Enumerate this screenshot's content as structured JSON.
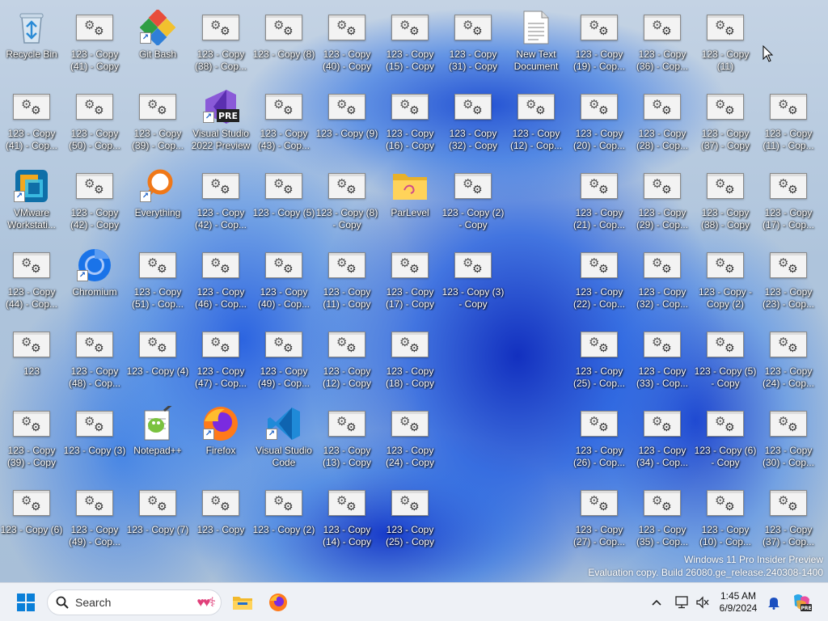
{
  "desktop": {
    "icons": [
      {
        "label": "Recycle Bin",
        "type": "recycle",
        "col": 0,
        "row": 0
      },
      {
        "label": "123 - Copy (41) - Copy",
        "type": "file",
        "col": 1,
        "row": 0
      },
      {
        "label": "Git Bash",
        "type": "gitbash",
        "col": 2,
        "row": 0,
        "shortcut": true
      },
      {
        "label": "123 - Copy (38) - Cop...",
        "type": "file",
        "col": 3,
        "row": 0
      },
      {
        "label": "123 - Copy (8)",
        "type": "file",
        "col": 4,
        "row": 0
      },
      {
        "label": "123 - Copy (40) - Copy",
        "type": "file",
        "col": 5,
        "row": 0
      },
      {
        "label": "123 - Copy (15) - Copy",
        "type": "file",
        "col": 6,
        "row": 0
      },
      {
        "label": "123 - Copy (31) - Copy",
        "type": "file",
        "col": 7,
        "row": 0
      },
      {
        "label": "New Text Document",
        "type": "text",
        "col": 8,
        "row": 0
      },
      {
        "label": "123 - Copy (19) - Cop...",
        "type": "file",
        "col": 9,
        "row": 0
      },
      {
        "label": "123 - Copy (36) - Cop...",
        "type": "file",
        "col": 10,
        "row": 0
      },
      {
        "label": "123 - Copy (11)",
        "type": "file",
        "col": 11,
        "row": 0
      },
      {
        "label": "123 - Copy (41) - Cop...",
        "type": "file",
        "col": 0,
        "row": 1
      },
      {
        "label": "123 - Copy (50) - Cop...",
        "type": "file",
        "col": 1,
        "row": 1
      },
      {
        "label": "123 - Copy (39) - Cop...",
        "type": "file",
        "col": 2,
        "row": 1
      },
      {
        "label": "Visual Studio 2022 Preview",
        "type": "vspre",
        "col": 3,
        "row": 1,
        "shortcut": true
      },
      {
        "label": "123 - Copy (43) - Cop...",
        "type": "file",
        "col": 4,
        "row": 1
      },
      {
        "label": "123 - Copy (9)",
        "type": "file",
        "col": 5,
        "row": 1
      },
      {
        "label": "123 - Copy (16) - Copy",
        "type": "file",
        "col": 6,
        "row": 1
      },
      {
        "label": "123 - Copy (32) - Copy",
        "type": "file",
        "col": 7,
        "row": 1
      },
      {
        "label": "123 - Copy (12) - Cop...",
        "type": "file",
        "col": 8,
        "row": 1
      },
      {
        "label": "123 - Copy (20) - Cop...",
        "type": "file",
        "col": 9,
        "row": 1
      },
      {
        "label": "123 - Copy (28) - Cop...",
        "type": "file",
        "col": 10,
        "row": 1
      },
      {
        "label": "123 - Copy (37) - Copy",
        "type": "file",
        "col": 11,
        "row": 1
      },
      {
        "label": "123 - Copy (11) - Cop...",
        "type": "file",
        "col": 12,
        "row": 1
      },
      {
        "label": "VMware Workstati...",
        "type": "vmware",
        "col": 0,
        "row": 2,
        "shortcut": true
      },
      {
        "label": "123 - Copy (42) - Copy",
        "type": "file",
        "col": 1,
        "row": 2
      },
      {
        "label": "Everything",
        "type": "everything",
        "col": 2,
        "row": 2,
        "shortcut": true
      },
      {
        "label": "123 - Copy (42) - Cop...",
        "type": "file",
        "col": 3,
        "row": 2
      },
      {
        "label": "123 - Copy (5)",
        "type": "file",
        "col": 4,
        "row": 2
      },
      {
        "label": "123 - Copy (8) - Copy",
        "type": "file",
        "col": 5,
        "row": 2
      },
      {
        "label": "ParLevel",
        "type": "folder",
        "col": 6,
        "row": 2
      },
      {
        "label": "123 - Copy (2) - Copy",
        "type": "file",
        "col": 7,
        "row": 2
      },
      {
        "label": "123 - Copy (21) - Cop...",
        "type": "file",
        "col": 9,
        "row": 2
      },
      {
        "label": "123 - Copy (29) - Cop...",
        "type": "file",
        "col": 10,
        "row": 2
      },
      {
        "label": "123 - Copy (38) - Copy",
        "type": "file",
        "col": 11,
        "row": 2
      },
      {
        "label": "123 - Copy (17) - Cop...",
        "type": "file",
        "col": 12,
        "row": 2
      },
      {
        "label": "123 - Copy (44) - Cop...",
        "type": "file",
        "col": 0,
        "row": 3
      },
      {
        "label": "Chromium",
        "type": "chromium",
        "col": 1,
        "row": 3,
        "shortcut": true
      },
      {
        "label": "123 - Copy (51) - Cop...",
        "type": "file",
        "col": 2,
        "row": 3
      },
      {
        "label": "123 - Copy (46) - Cop...",
        "type": "file",
        "col": 3,
        "row": 3
      },
      {
        "label": "123 - Copy (40) - Cop...",
        "type": "file",
        "col": 4,
        "row": 3
      },
      {
        "label": "123 - Copy (11) - Copy",
        "type": "file",
        "col": 5,
        "row": 3
      },
      {
        "label": "123 - Copy (17) - Copy",
        "type": "file",
        "col": 6,
        "row": 3
      },
      {
        "label": "123 - Copy (3) - Copy",
        "type": "file",
        "col": 7,
        "row": 3
      },
      {
        "label": "123 - Copy (22) - Cop...",
        "type": "file",
        "col": 9,
        "row": 3
      },
      {
        "label": "123 - Copy (32) - Cop...",
        "type": "file",
        "col": 10,
        "row": 3
      },
      {
        "label": "123 - Copy - Copy (2)",
        "type": "file",
        "col": 11,
        "row": 3
      },
      {
        "label": "123 - Copy (23) - Cop...",
        "type": "file",
        "col": 12,
        "row": 3
      },
      {
        "label": "123",
        "type": "file",
        "col": 0,
        "row": 4
      },
      {
        "label": "123 - Copy (48) - Cop...",
        "type": "file",
        "col": 1,
        "row": 4
      },
      {
        "label": "123 - Copy (4)",
        "type": "file",
        "col": 2,
        "row": 4
      },
      {
        "label": "123 - Copy (47) - Cop...",
        "type": "file",
        "col": 3,
        "row": 4
      },
      {
        "label": "123 - Copy (49) - Cop...",
        "type": "file",
        "col": 4,
        "row": 4
      },
      {
        "label": "123 - Copy (12) - Copy",
        "type": "file",
        "col": 5,
        "row": 4
      },
      {
        "label": "123 - Copy (18) - Copy",
        "type": "file",
        "col": 6,
        "row": 4
      },
      {
        "label": "123 - Copy (25) - Cop...",
        "type": "file",
        "col": 9,
        "row": 4
      },
      {
        "label": "123 - Copy (33) - Cop...",
        "type": "file",
        "col": 10,
        "row": 4
      },
      {
        "label": "123 - Copy (5) - Copy",
        "type": "file",
        "col": 11,
        "row": 4
      },
      {
        "label": "123 - Copy (24) - Cop...",
        "type": "file",
        "col": 12,
        "row": 4
      },
      {
        "label": "123 - Copy (39) - Copy",
        "type": "file",
        "col": 0,
        "row": 5
      },
      {
        "label": "123 - Copy (3)",
        "type": "file",
        "col": 1,
        "row": 5
      },
      {
        "label": "Notepad++",
        "type": "notepadpp",
        "col": 2,
        "row": 5
      },
      {
        "label": "Firefox",
        "type": "firefox",
        "col": 3,
        "row": 5,
        "shortcut": true
      },
      {
        "label": "Visual Studio Code",
        "type": "vscode",
        "col": 4,
        "row": 5,
        "shortcut": true
      },
      {
        "label": "123 - Copy (13) - Copy",
        "type": "file",
        "col": 5,
        "row": 5
      },
      {
        "label": "123 - Copy (24) - Copy",
        "type": "file",
        "col": 6,
        "row": 5
      },
      {
        "label": "123 - Copy (26) - Cop...",
        "type": "file",
        "col": 9,
        "row": 5
      },
      {
        "label": "123 - Copy (34) - Cop...",
        "type": "file",
        "col": 10,
        "row": 5
      },
      {
        "label": "123 - Copy (6) - Copy",
        "type": "file",
        "col": 11,
        "row": 5
      },
      {
        "label": "123 - Copy (30) - Cop...",
        "type": "file",
        "col": 12,
        "row": 5
      },
      {
        "label": "123 - Copy (6)",
        "type": "file",
        "col": 0,
        "row": 6
      },
      {
        "label": "123 - Copy (49) - Cop...",
        "type": "file",
        "col": 1,
        "row": 6
      },
      {
        "label": "123 - Copy (7)",
        "type": "file",
        "col": 2,
        "row": 6
      },
      {
        "label": "123 - Copy",
        "type": "file",
        "col": 3,
        "row": 6
      },
      {
        "label": "123 - Copy (2)",
        "type": "file",
        "col": 4,
        "row": 6
      },
      {
        "label": "123 - Copy (14) - Copy",
        "type": "file",
        "col": 5,
        "row": 6
      },
      {
        "label": "123 - Copy (25) - Copy",
        "type": "file",
        "col": 6,
        "row": 6
      },
      {
        "label": "123 - Copy (27) - Cop...",
        "type": "file",
        "col": 9,
        "row": 6
      },
      {
        "label": "123 - Copy (35) - Cop...",
        "type": "file",
        "col": 10,
        "row": 6
      },
      {
        "label": "123 - Copy (10) - Cop...",
        "type": "file",
        "col": 11,
        "row": 6
      },
      {
        "label": "123 - Copy (37) - Cop...",
        "type": "file",
        "col": 12,
        "row": 6
      }
    ]
  },
  "watermark": {
    "line1": "Windows 11 Pro Insider Preview",
    "line2": "Evaluation copy. Build 26080.ge_release.240308-1400"
  },
  "taskbar": {
    "search_placeholder": "Search",
    "time": "1:45 AM",
    "date": "6/9/2024"
  },
  "colors": {
    "accent": "#0067c0",
    "taskbar_bg": "#eef1f6"
  }
}
